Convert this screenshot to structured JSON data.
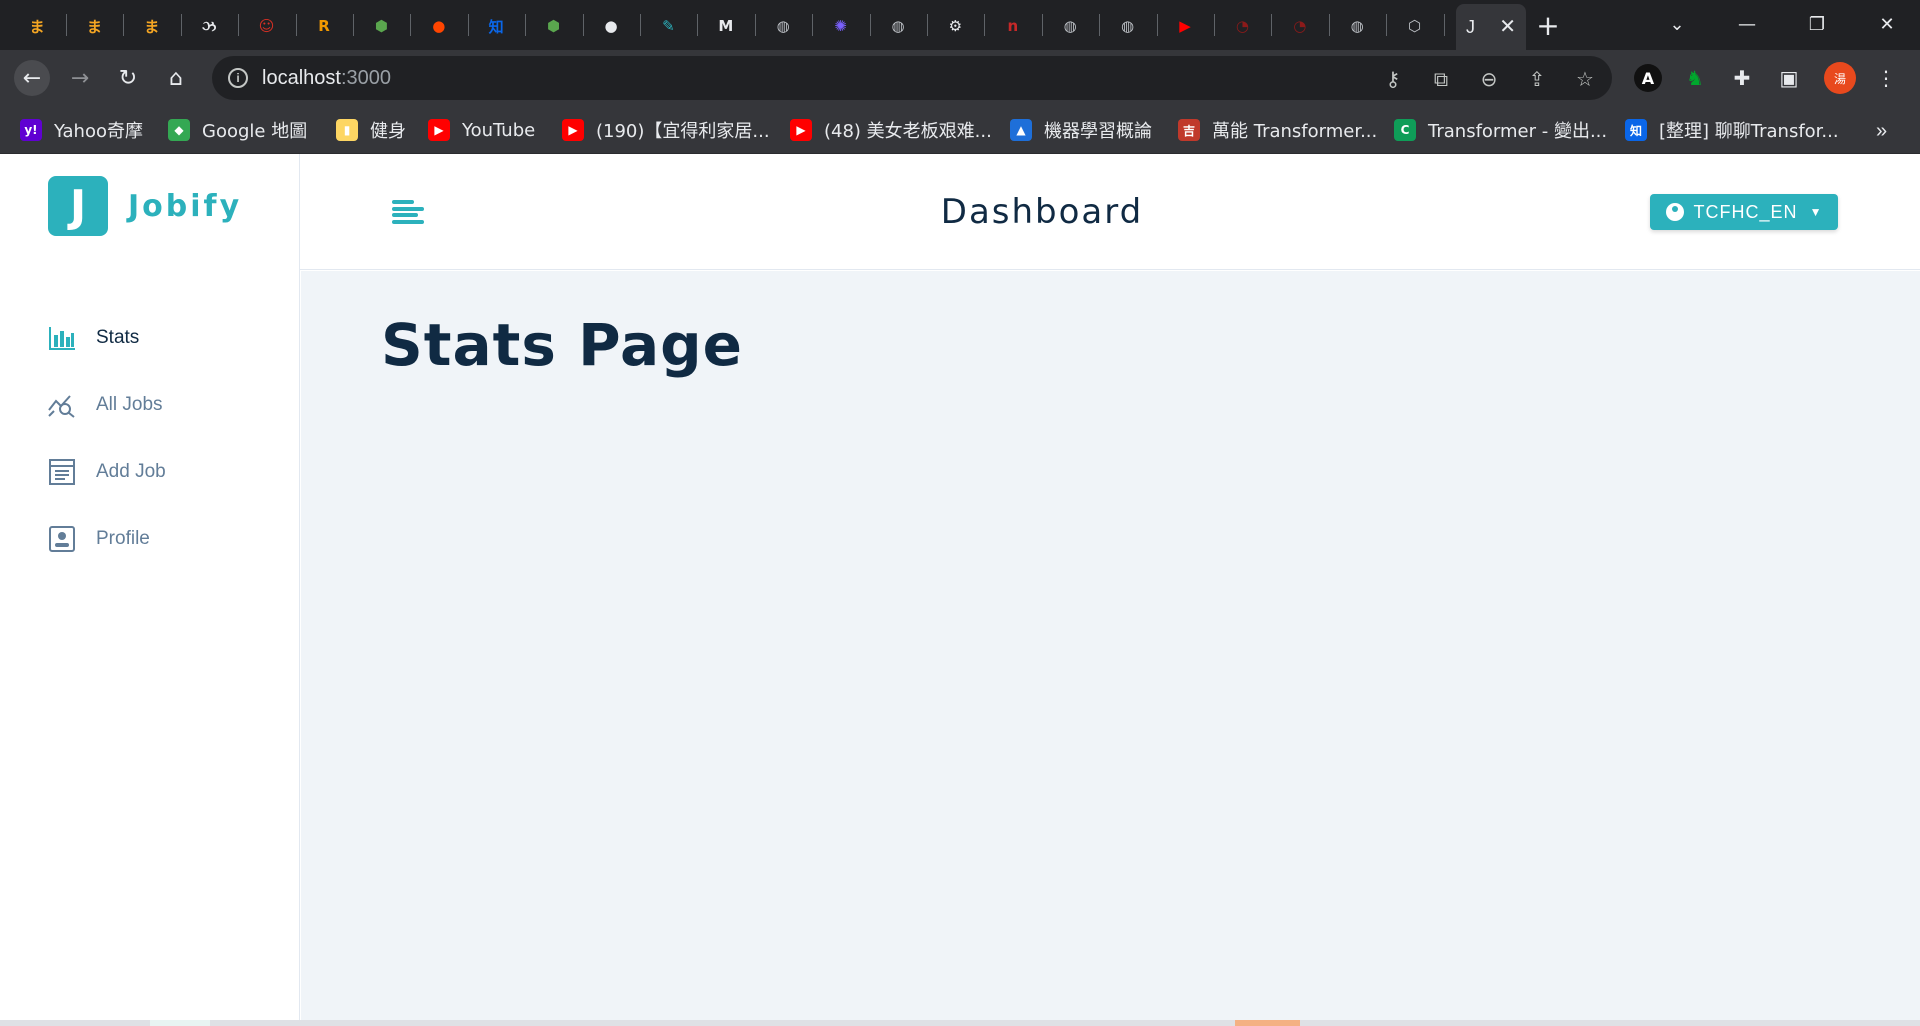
{
  "browser": {
    "tabs": [
      {
        "icon": "tab-favicon-1",
        "color": "#f5a623",
        "glyph": "ま"
      },
      {
        "icon": "tab-favicon-2",
        "color": "#f5a623",
        "glyph": "ま"
      },
      {
        "icon": "tab-favicon-3",
        "color": "#f5a623",
        "glyph": "ま"
      },
      {
        "icon": "tab-favicon-4",
        "color": "#e8eaed",
        "glyph": "ઝ"
      },
      {
        "icon": "tab-favicon-5",
        "color": "#d93025",
        "glyph": "☺"
      },
      {
        "icon": "tab-favicon-6",
        "color": "#f29900",
        "glyph": "R"
      },
      {
        "icon": "tab-favicon-7",
        "color": "#5aa64e",
        "glyph": "⬢"
      },
      {
        "icon": "reddit-icon",
        "color": "#ff4500",
        "glyph": "●"
      },
      {
        "icon": "zhihu-icon",
        "color": "#0a66e8",
        "glyph": "知"
      },
      {
        "icon": "nodejs-icon",
        "color": "#5aa64e",
        "glyph": "⬢"
      },
      {
        "icon": "github-icon",
        "color": "#e8eaed",
        "glyph": "●"
      },
      {
        "icon": "tab-favicon-12",
        "color": "#2cb1bc",
        "glyph": "✎"
      },
      {
        "icon": "tab-favicon-13",
        "color": "#e8eaed",
        "glyph": "M"
      },
      {
        "icon": "globe-icon",
        "color": "#bdc1c6",
        "glyph": "◍"
      },
      {
        "icon": "tab-favicon-15",
        "color": "#7b61ff",
        "glyph": "✺"
      },
      {
        "icon": "globe-icon",
        "color": "#bdc1c6",
        "glyph": "◍"
      },
      {
        "icon": "gear-icon",
        "color": "#e8eaed",
        "glyph": "⚙"
      },
      {
        "icon": "tab-favicon-18",
        "color": "#c62828",
        "glyph": "n"
      },
      {
        "icon": "globe-icon",
        "color": "#bdc1c6",
        "glyph": "◍"
      },
      {
        "icon": "globe-icon",
        "color": "#bdc1c6",
        "glyph": "◍"
      },
      {
        "icon": "youtube-icon",
        "color": "#ff0000",
        "glyph": "▶"
      },
      {
        "icon": "tab-favicon-22",
        "color": "#8b1a1a",
        "glyph": "◔"
      },
      {
        "icon": "tab-favicon-23",
        "color": "#8b1a1a",
        "glyph": "◔"
      },
      {
        "icon": "globe-icon",
        "color": "#bdc1c6",
        "glyph": "◍"
      },
      {
        "icon": "cube-icon",
        "color": "#bdc1c6",
        "glyph": "⬡"
      }
    ],
    "active_tab": {
      "glyph": "J",
      "close": "✕"
    },
    "new_tab": "+",
    "window": {
      "list": "⌄",
      "minimize": "—",
      "restore": "❐",
      "close": "✕"
    },
    "nav": {
      "back": "←",
      "forward": "→",
      "reload": "↻",
      "home": "⌂"
    },
    "address": {
      "host": "localhost",
      "port": ":3000"
    },
    "omnibox_icons": [
      "key-icon",
      "translate-icon",
      "zoom-out-icon",
      "share-icon",
      "star-icon"
    ],
    "profile_initial": "湯",
    "bookmarks": [
      {
        "label": "Yahoo奇摩",
        "color": "#6001d2",
        "glyph": "y!"
      },
      {
        "label": "Google 地圖",
        "color": "#34a853",
        "glyph": "◆"
      },
      {
        "label": "健身",
        "color": "#fdd663",
        "glyph": "▮"
      },
      {
        "label": "YouTube",
        "color": "#ff0000",
        "glyph": "▶"
      },
      {
        "label": "(190)【宜得利家居...",
        "color": "#ff0000",
        "glyph": "▶"
      },
      {
        "label": "(48) 美女老板艰难...",
        "color": "#ff0000",
        "glyph": "▶"
      },
      {
        "label": "機器學習概論",
        "color": "#1e6fd9",
        "glyph": "▲"
      },
      {
        "label": "萬能 Transformer...",
        "color": "#c0392b",
        "glyph": "吉"
      },
      {
        "label": "Transformer - 變出...",
        "color": "#0f9d58",
        "glyph": "C"
      },
      {
        "label": "[整理] 聊聊Transfor...",
        "color": "#0a66e8",
        "glyph": "知"
      }
    ],
    "bookmarks_more": "»"
  },
  "app": {
    "logo_letter": "J",
    "logo_name": "Jobify",
    "nav": [
      {
        "label": "Stats",
        "icon": "stats-icon",
        "active": true
      },
      {
        "label": "All Jobs",
        "icon": "all-jobs-icon",
        "active": false
      },
      {
        "label": "Add Job",
        "icon": "add-job-icon",
        "active": false
      },
      {
        "label": "Profile",
        "icon": "profile-icon",
        "active": false
      }
    ],
    "header_title": "Dashboard",
    "user_name": "TCFHC_EN",
    "page_heading": "Stats Page",
    "accent": "#2cb1bc",
    "text_dark": "#102a43",
    "text_muted": "#627d98",
    "main_bg": "#f0f4f8"
  }
}
